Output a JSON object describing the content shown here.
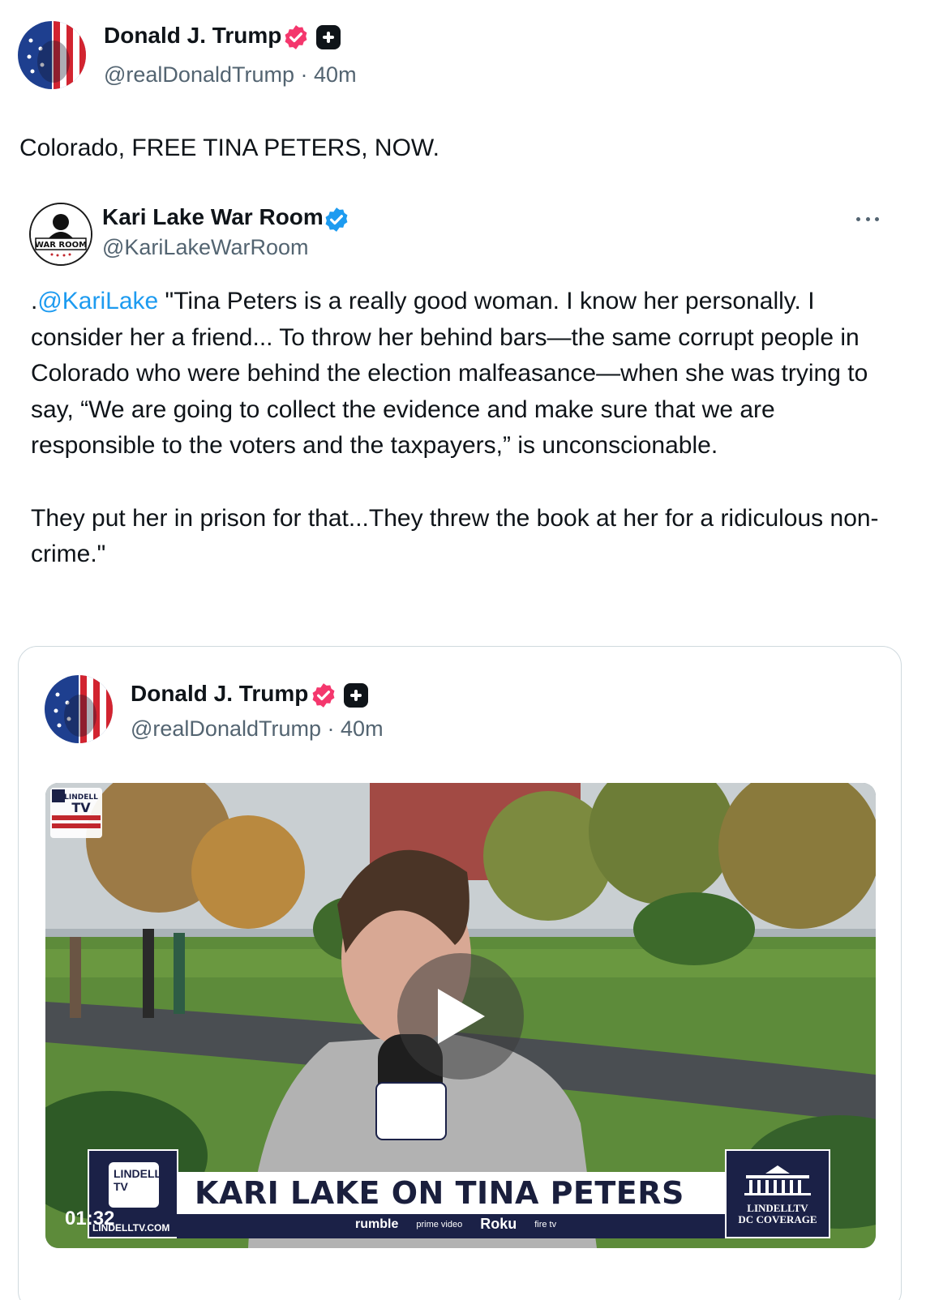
{
  "post": {
    "author_name": "Donald J. Trump",
    "author_handle": "@realDonaldTrump",
    "separator": "·",
    "time": "40m",
    "text": "Colorado, FREE TINA PETERS, NOW."
  },
  "quote": {
    "author_name": "Kari Lake War Room",
    "author_handle": "@KariLakeWarRoom",
    "mention": "@KariLake",
    "lead": ".",
    "body_line1_rest": " \"Tina Peters is a really good woman. I know her personally. I consider her a friend... To throw her behind bars—the same corrupt people in Colorado who were behind the election malfeasance—when she was trying to say, “We are going to collect the evidence and make sure that we are responsible to the voters and the taxpayers,” is unconscionable.",
    "body_paragraph2": "They put her in prison for that...They threw the book at her for a ridiculous non-crime.\""
  },
  "embed": {
    "author_name": "Donald J. Trump",
    "author_handle": "@realDonaldTrump",
    "separator": "·",
    "time": "40m"
  },
  "video": {
    "duration": "01:32",
    "lower_third_title": "KARI LAKE ON TINA PETERS",
    "channel_logo_text": "LINDELL TV",
    "channel_site": "LINDELLTV.COM",
    "platforms": [
      "rumble",
      "prime video",
      "Roku",
      "fire tv"
    ],
    "dc_label_line1": "LINDELLTV",
    "dc_label_line2": "DC COVERAGE",
    "corner_logo_text": "LINDELL TV"
  },
  "colors": {
    "verified_pink": "#f4376d",
    "verified_blue": "#1d9bf0",
    "link_blue": "#1d9bf0",
    "muted_gray": "#536471",
    "text_dark": "#0f1419"
  },
  "icons": {
    "verified_badge": "verified-badge-icon",
    "plus_badge": "plus-badge-icon",
    "more": "more-icon",
    "play": "play-icon"
  }
}
